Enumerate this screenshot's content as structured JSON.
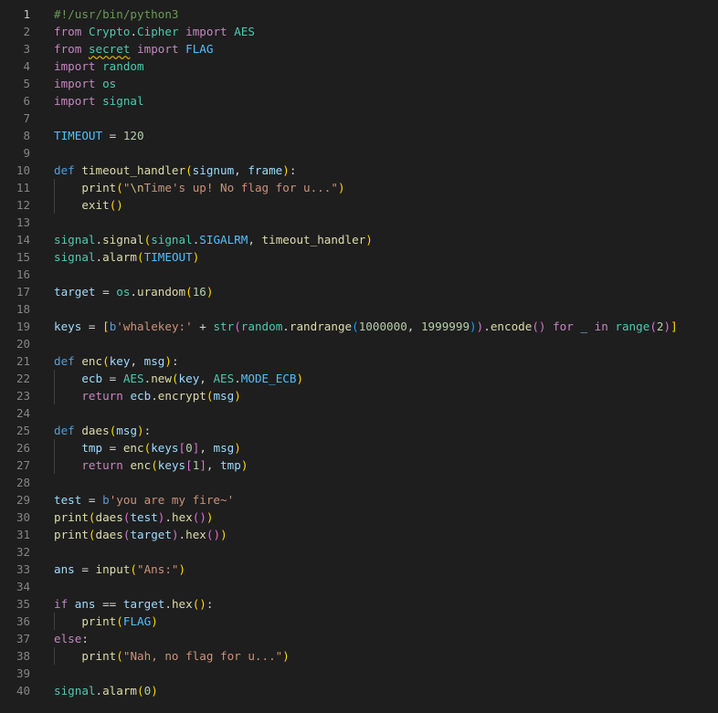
{
  "editor": {
    "language": "python",
    "active_line": 1,
    "colors": {
      "background": "#1e1e1e",
      "line_number": "#858585",
      "active_line_number": "#c6c6c6",
      "keyword": "#569cd6",
      "control_keyword": "#c586c0",
      "function": "#dcdcaa",
      "variable": "#9cdcfe",
      "string": "#ce9178",
      "number": "#b5cea8",
      "constant": "#4fc1ff",
      "comment": "#6a9955",
      "warning_squiggle": "#cca700"
    },
    "lines": [
      {
        "n": "1",
        "text": "#!/usr/bin/python3"
      },
      {
        "n": "2",
        "text": "from Crypto.Cipher import AES"
      },
      {
        "n": "3",
        "text": "from secret import FLAG"
      },
      {
        "n": "4",
        "text": "import random"
      },
      {
        "n": "5",
        "text": "import os"
      },
      {
        "n": "6",
        "text": "import signal"
      },
      {
        "n": "7",
        "text": ""
      },
      {
        "n": "8",
        "text": "TIMEOUT = 120"
      },
      {
        "n": "9",
        "text": ""
      },
      {
        "n": "10",
        "text": "def timeout_handler(signum, frame):"
      },
      {
        "n": "11",
        "text": "    print(\"\\nTime's up! No flag for u...\")"
      },
      {
        "n": "12",
        "text": "    exit()"
      },
      {
        "n": "13",
        "text": ""
      },
      {
        "n": "14",
        "text": "signal.signal(signal.SIGALRM, timeout_handler)"
      },
      {
        "n": "15",
        "text": "signal.alarm(TIMEOUT)"
      },
      {
        "n": "16",
        "text": ""
      },
      {
        "n": "17",
        "text": "target = os.urandom(16)"
      },
      {
        "n": "18",
        "text": ""
      },
      {
        "n": "19",
        "text": "keys = [b'whalekey:' + str(random.randrange(1000000, 1999999)).encode() for _ in range(2)]"
      },
      {
        "n": "20",
        "text": ""
      },
      {
        "n": "21",
        "text": "def enc(key, msg):"
      },
      {
        "n": "22",
        "text": "    ecb = AES.new(key, AES.MODE_ECB)"
      },
      {
        "n": "23",
        "text": "    return ecb.encrypt(msg)"
      },
      {
        "n": "24",
        "text": ""
      },
      {
        "n": "25",
        "text": "def daes(msg):"
      },
      {
        "n": "26",
        "text": "    tmp = enc(keys[0], msg)"
      },
      {
        "n": "27",
        "text": "    return enc(keys[1], tmp)"
      },
      {
        "n": "28",
        "text": ""
      },
      {
        "n": "29",
        "text": "test = b'you are my fire~'"
      },
      {
        "n": "30",
        "text": "print(daes(test).hex())"
      },
      {
        "n": "31",
        "text": "print(daes(target).hex())"
      },
      {
        "n": "32",
        "text": ""
      },
      {
        "n": "33",
        "text": "ans = input(\"Ans:\")"
      },
      {
        "n": "34",
        "text": ""
      },
      {
        "n": "35",
        "text": "if ans == target.hex():"
      },
      {
        "n": "36",
        "text": "    print(FLAG)"
      },
      {
        "n": "37",
        "text": "else:"
      },
      {
        "n": "38",
        "text": "    print(\"Nah, no flag for u...\")"
      },
      {
        "n": "39",
        "text": ""
      },
      {
        "n": "40",
        "text": "signal.alarm(0)"
      }
    ]
  }
}
